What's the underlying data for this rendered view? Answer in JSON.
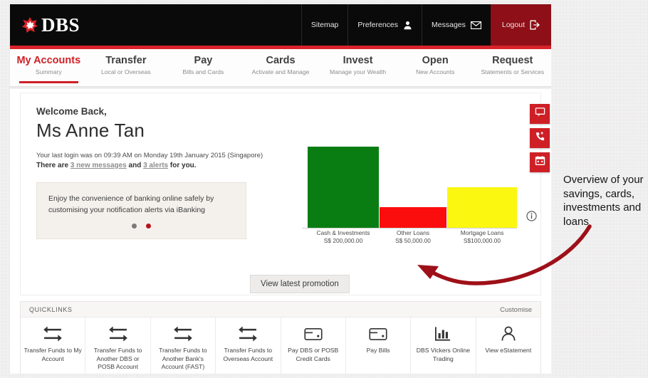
{
  "brand": {
    "name": "DBS",
    "accent": "#cf1f26",
    "logo_icon": "dbs-star-icon"
  },
  "topnav": [
    {
      "label": "Sitemap",
      "icon": ""
    },
    {
      "label": "Preferences",
      "icon": "user-icon"
    },
    {
      "label": "Messages",
      "icon": "envelope-icon"
    },
    {
      "label": "Logout",
      "icon": "logout-icon"
    }
  ],
  "tabs": [
    {
      "title": "My Accounts",
      "sub": "Summary",
      "active": true
    },
    {
      "title": "Transfer",
      "sub": "Local or Overseas",
      "active": false
    },
    {
      "title": "Pay",
      "sub": "Bills and Cards",
      "active": false
    },
    {
      "title": "Cards",
      "sub": "Activate and Manage",
      "active": false
    },
    {
      "title": "Invest",
      "sub": "Manage your Wealth",
      "active": false
    },
    {
      "title": "Open",
      "sub": "New Accounts",
      "active": false
    },
    {
      "title": "Request",
      "sub": "Statements or Services",
      "active": false
    }
  ],
  "welcome": {
    "greeting": "Welcome Back,",
    "name": "Ms Anne Tan",
    "last_login": "Your last login was on 09:39 AM on Monday 19th January 2015 (Singapore)",
    "messages_prefix": "There are ",
    "messages_link": "3 new messages",
    "messages_mid": " and ",
    "alerts_link": "3 alerts",
    "messages_suffix": " for you."
  },
  "promo": {
    "text": "Enjoy the convenience of banking online safely by customising your notification alerts via iBanking",
    "button_label": "View latest promotion",
    "dots": 2,
    "active_dot": 2
  },
  "chart_data": {
    "type": "bar",
    "categories": [
      "Cash & Investments",
      "Other Loans",
      "Mortgage Loans"
    ],
    "values": [
      200000,
      50000,
      100000
    ],
    "value_labels": [
      "S$ 200,000.00",
      "S$ 50,000.00",
      "S$100,000.00"
    ],
    "colors": [
      "#0a7d12",
      "#fc0d0d",
      "#fbf711"
    ],
    "title": "",
    "xlabel": "",
    "ylabel": "",
    "ylim": [
      0,
      200000
    ],
    "grid": false,
    "legend": "none",
    "currency": "SGD",
    "info_icon": "info-circle-icon"
  },
  "side_tabs": [
    {
      "icon": "chat-bubble-icon",
      "name": "live-chat"
    },
    {
      "icon": "phone-callback-icon",
      "name": "call-back"
    },
    {
      "icon": "calendar-icon",
      "name": "book-appointment"
    }
  ],
  "quicklinks": {
    "title": "QUICKLINKS",
    "customise_label": "Customise",
    "items": [
      {
        "label": "Transfer Funds to My Account",
        "icon": "transfer-arrows-icon"
      },
      {
        "label": "Transfer Funds to Another DBS or POSB Account",
        "icon": "transfer-arrows-icon"
      },
      {
        "label": "Transfer Funds to Another Bank's Account (FAST)",
        "icon": "transfer-arrows-icon"
      },
      {
        "label": "Transfer Funds to Overseas Account",
        "icon": "transfer-arrows-icon"
      },
      {
        "label": "Pay DBS or POSB Credit Cards",
        "icon": "card-wallet-icon"
      },
      {
        "label": "Pay Bills",
        "icon": "card-wallet-icon"
      },
      {
        "label": "DBS Vickers Online Trading",
        "icon": "bar-chart-icon"
      },
      {
        "label": "View eStatement",
        "icon": "person-icon"
      }
    ]
  },
  "annotation": {
    "text": "Overview of your savings, cards, investments and loans",
    "color": "#9e1019",
    "arrow_icon": "curved-arrow-icon"
  }
}
